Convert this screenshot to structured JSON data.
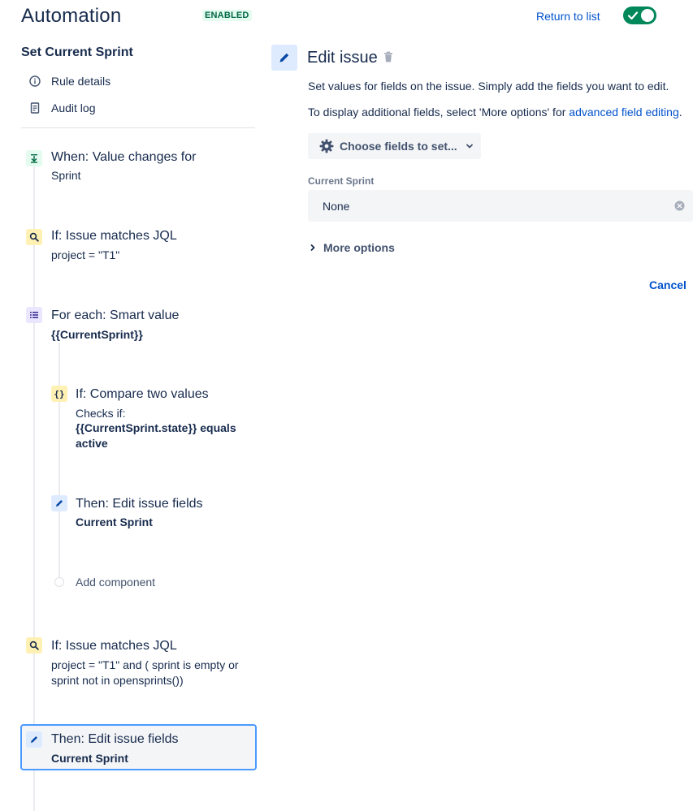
{
  "header": {
    "title": "Automation",
    "status_badge": "ENABLED",
    "return_link": "Return to list"
  },
  "sidebar": {
    "rule_name": "Set Current Sprint",
    "nav": [
      {
        "label": "Rule details",
        "icon": "info-icon"
      },
      {
        "label": "Audit log",
        "icon": "document-icon"
      }
    ]
  },
  "flow": {
    "trigger": {
      "title": "When: Value changes for",
      "detail": "Sprint",
      "icon": "trigger-icon"
    },
    "condition1": {
      "title": "If: Issue matches JQL",
      "detail": "project = \"T1\"",
      "icon": "search-icon"
    },
    "branch": {
      "title": "For each: Smart value",
      "detail": "{{CurrentSprint}}",
      "icon": "list-icon"
    },
    "nested_condition": {
      "title": "If: Compare two values",
      "detail_prefix": "Checks if:",
      "detail_line1": "{{CurrentSprint.state}} equals",
      "detail_line2": "active",
      "icon": "braces-icon"
    },
    "nested_action": {
      "title": "Then: Edit issue fields",
      "detail": "Current Sprint",
      "icon": "pencil-icon"
    },
    "add_component": "Add component",
    "condition2": {
      "title": "If: Issue matches JQL",
      "detail_line1": "project = \"T1\" and ( sprint is empty or",
      "detail_line2": "sprint not in opensprints())",
      "icon": "search-icon"
    },
    "selected_action": {
      "title": "Then: Edit issue fields",
      "detail": "Current Sprint",
      "icon": "pencil-icon"
    }
  },
  "editor": {
    "title": "Edit issue",
    "description": "Set values for fields on the issue. Simply add the fields you want to edit.",
    "hint_prefix": "To display additional fields, select 'More options' for ",
    "hint_link": "advanced field editing",
    "hint_suffix": ".",
    "choose_fields_button": "Choose fields to set...",
    "field_label": "Current Sprint",
    "field_value": "None",
    "more_options": "More options",
    "cancel": "Cancel"
  },
  "colors": {
    "accent": "#0052cc",
    "toggle_on": "#00875a",
    "selected_border": "#4c9aff"
  }
}
